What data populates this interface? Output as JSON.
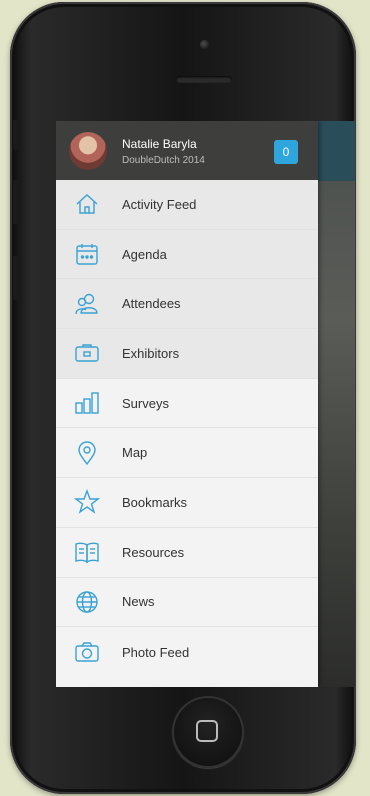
{
  "colors": {
    "accent": "#2ea6dd",
    "icon": "#3aa2d3",
    "header_bg": "#3e3e3d",
    "page_bg": "#e3e5c9"
  },
  "profile": {
    "name": "Natalie Baryla",
    "subtitle": "DoubleDutch 2014",
    "badge_count": "0"
  },
  "menu": [
    {
      "label": "Activity Feed",
      "icon": "home-icon"
    },
    {
      "label": "Agenda",
      "icon": "calendar-icon"
    },
    {
      "label": "Attendees",
      "icon": "people-icon"
    },
    {
      "label": "Exhibitors",
      "icon": "exhibitor-icon"
    },
    {
      "label": "Surveys",
      "icon": "bar-chart-icon"
    },
    {
      "label": "Map",
      "icon": "map-pin-icon"
    },
    {
      "label": "Bookmarks",
      "icon": "star-icon"
    },
    {
      "label": "Resources",
      "icon": "book-icon"
    },
    {
      "label": "News",
      "icon": "globe-icon"
    },
    {
      "label": "Photo Feed",
      "icon": "camera-icon"
    }
  ]
}
